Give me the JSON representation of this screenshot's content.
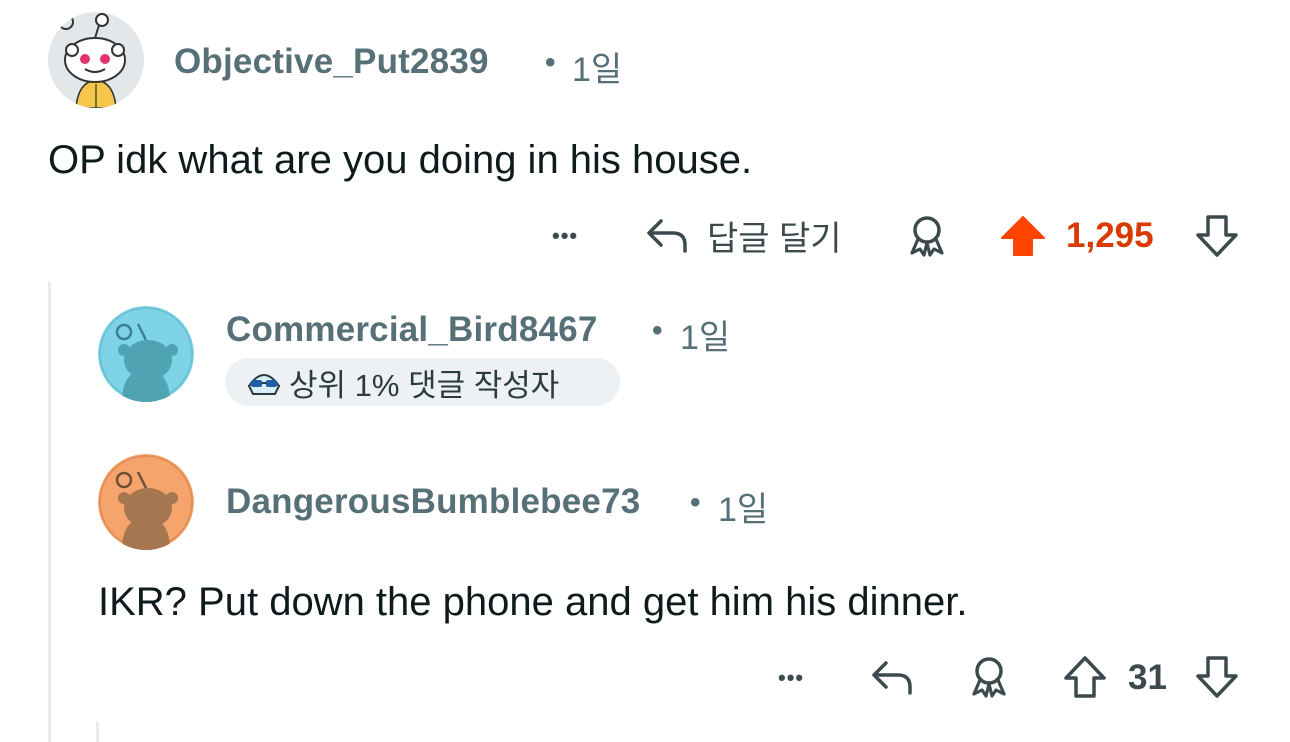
{
  "comments": [
    {
      "username": "Objective_Put2839",
      "separator": "•",
      "time": "1일",
      "avatar_icon": "snoo-avatar-white-yellow",
      "body": "OP idk what are you doing in his house.",
      "actions": {
        "more_label": "•••",
        "reply_label": "답글 달기",
        "vote_count": "1,295",
        "upvoted": true,
        "upvote_color": "#ff4500",
        "count_color": "#d93a00"
      }
    },
    {
      "username": "Commercial_Bird8467",
      "separator": "•",
      "time": "1일",
      "avatar_icon": "snoo-avatar-teal",
      "badge_label": "상위 1% 댓글 작성자"
    },
    {
      "username": "DangerousBumblebee73",
      "separator": "•",
      "time": "1일",
      "avatar_icon": "snoo-avatar-orange",
      "body": "IKR?  Put down the phone and get him his dinner.",
      "actions": {
        "more_label": "•••",
        "vote_count": "31",
        "upvoted": false
      }
    }
  ]
}
